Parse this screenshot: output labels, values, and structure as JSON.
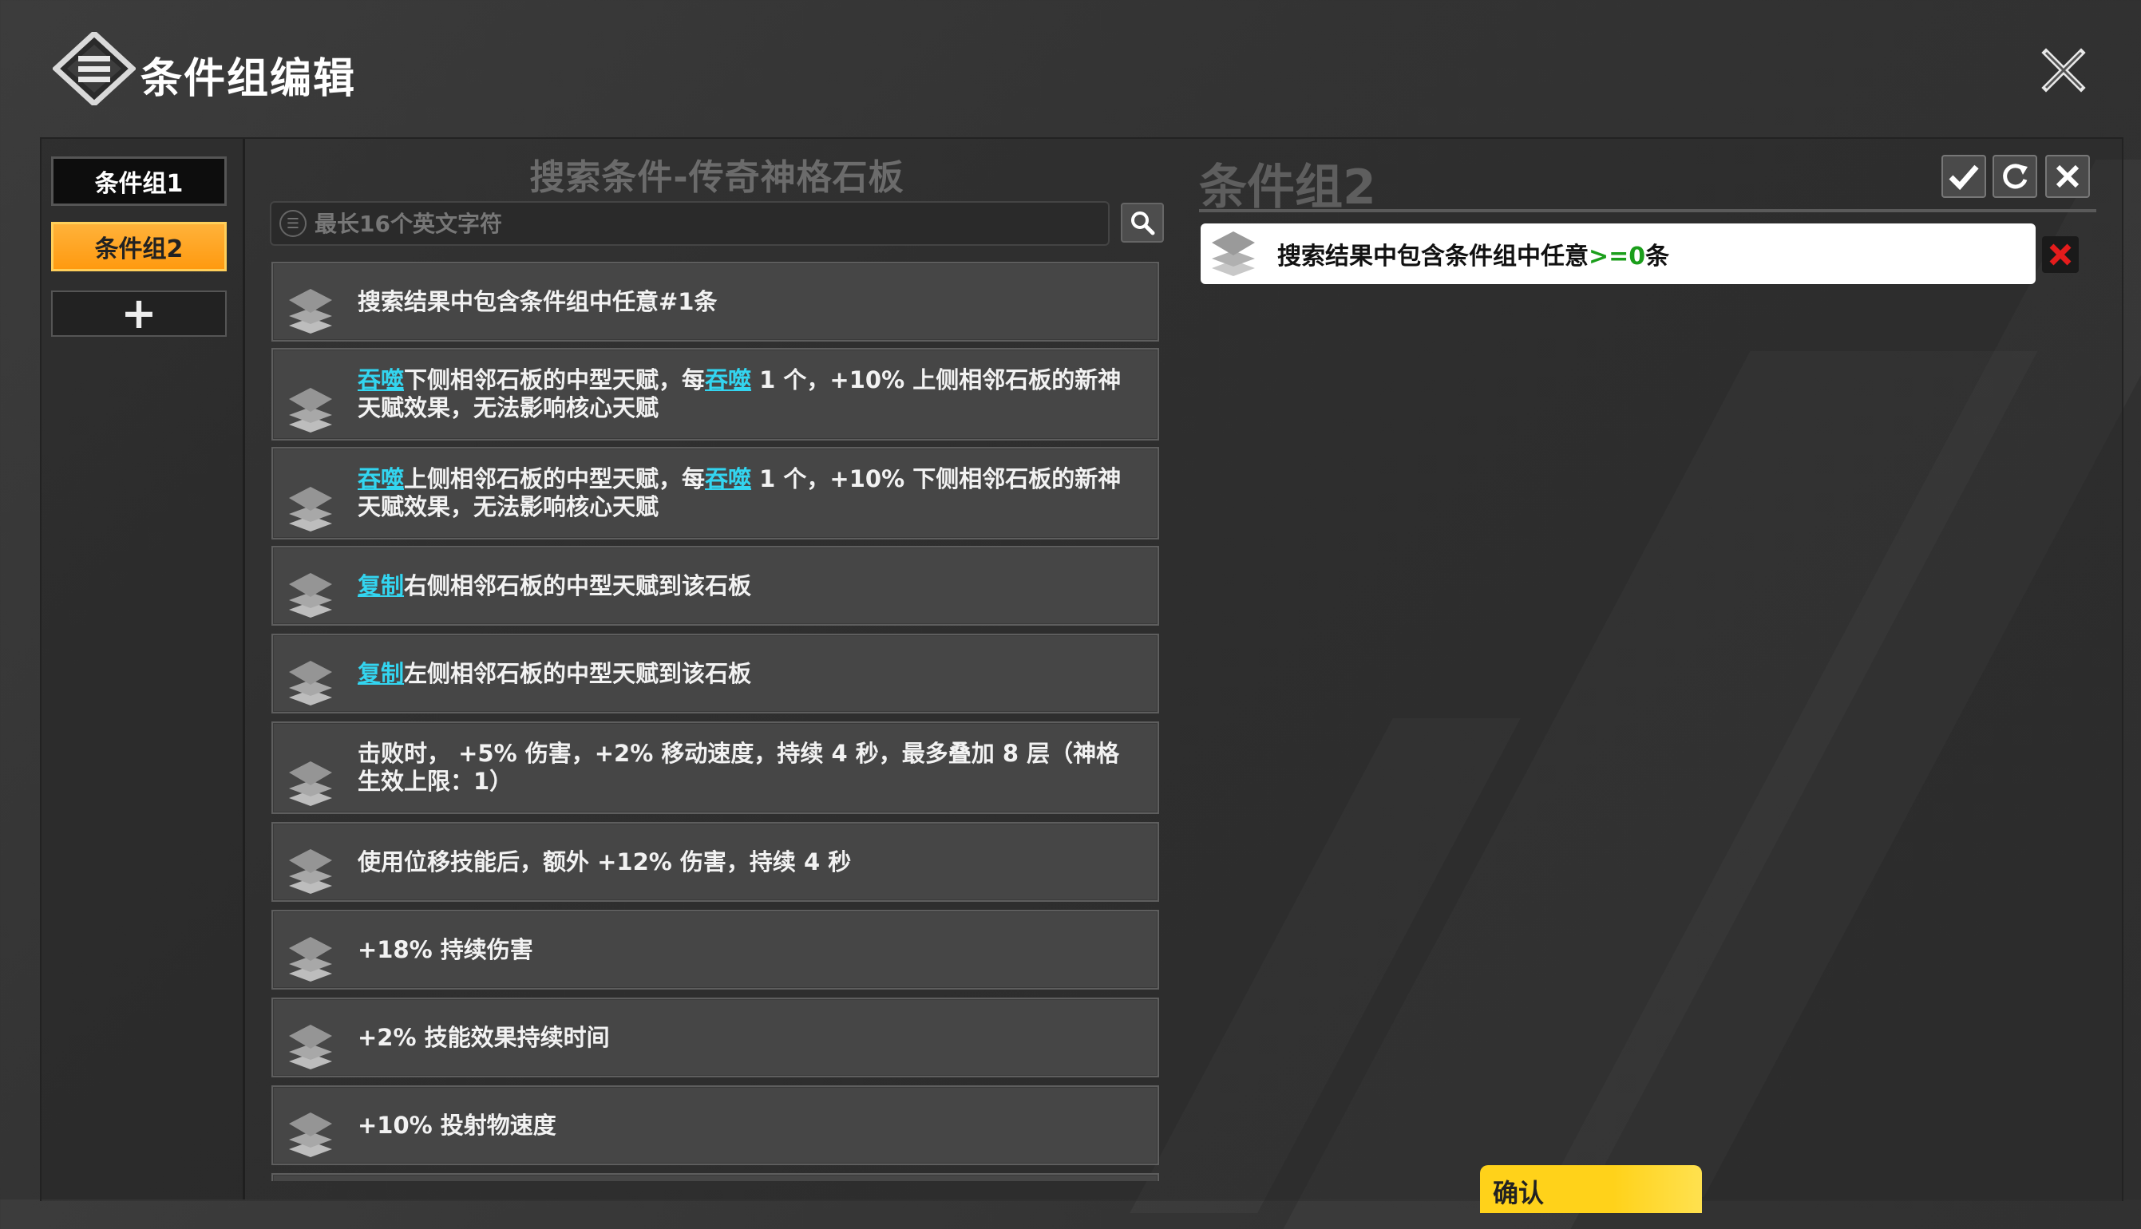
{
  "header": {
    "title": "条件组编辑",
    "logo_icon": "diamond-logo-icon",
    "close_icon": "close-icon"
  },
  "sidebar": {
    "groups": [
      {
        "label": "条件组1",
        "selected": false
      },
      {
        "label": "条件组2",
        "selected": true
      }
    ],
    "add_label": "+"
  },
  "search": {
    "title": "搜索条件-传奇神格石板",
    "placeholder": "最长16个英文字符",
    "value": "",
    "button_icon": "search-icon",
    "results": [
      {
        "parts": [
          {
            "t": "搜索结果中包含条件组中任意#1条"
          }
        ]
      },
      {
        "parts": [
          {
            "t": "吞噬",
            "kw": true
          },
          {
            "t": "下侧相邻石板的中型天赋，每"
          },
          {
            "t": "吞噬",
            "kw": true
          },
          {
            "t": " 1 个，+10% 上侧相邻石板的新神天赋效果，无法影响核心天赋"
          }
        ]
      },
      {
        "parts": [
          {
            "t": "吞噬",
            "kw": true
          },
          {
            "t": "上侧相邻石板的中型天赋，每"
          },
          {
            "t": "吞噬",
            "kw": true
          },
          {
            "t": " 1 个，+10% 下侧相邻石板的新神天赋效果，无法影响核心天赋"
          }
        ]
      },
      {
        "parts": [
          {
            "t": "复制",
            "kw": true
          },
          {
            "t": "右侧相邻石板的中型天赋到该石板"
          }
        ]
      },
      {
        "parts": [
          {
            "t": "复制",
            "kw": true
          },
          {
            "t": "左侧相邻石板的中型天赋到该石板"
          }
        ]
      },
      {
        "parts": [
          {
            "t": "击败时， +5% 伤害，+2% 移动速度，持续 4 秒，最多叠加 8 层（神格生效上限：1）"
          }
        ]
      },
      {
        "parts": [
          {
            "t": "使用位移技能后，额外 +12% 伤害，持续 4 秒"
          }
        ]
      },
      {
        "parts": [
          {
            "t": "+18% 持续伤害"
          }
        ]
      },
      {
        "parts": [
          {
            "t": "+2% 技能效果持续时间"
          }
        ]
      },
      {
        "parts": [
          {
            "t": "+10% 投射物速度"
          }
        ]
      }
    ]
  },
  "group_panel": {
    "title": "条件组2",
    "tools": [
      "check-icon",
      "refresh-icon",
      "close-icon"
    ],
    "condition": {
      "prefix": "搜索结果中包含条件组中任意",
      "op": ">=",
      "count": "0",
      "suffix": "条"
    },
    "delete_icon": "delete-x-icon"
  },
  "confirm_label": "确认",
  "colors": {
    "accent_orange": "#ff9a10",
    "keyword_cyan": "#33d5f0",
    "confirm_yellow": "#ffd21a",
    "op_green": "#1b9e1b",
    "delete_red": "#e51c1c"
  }
}
